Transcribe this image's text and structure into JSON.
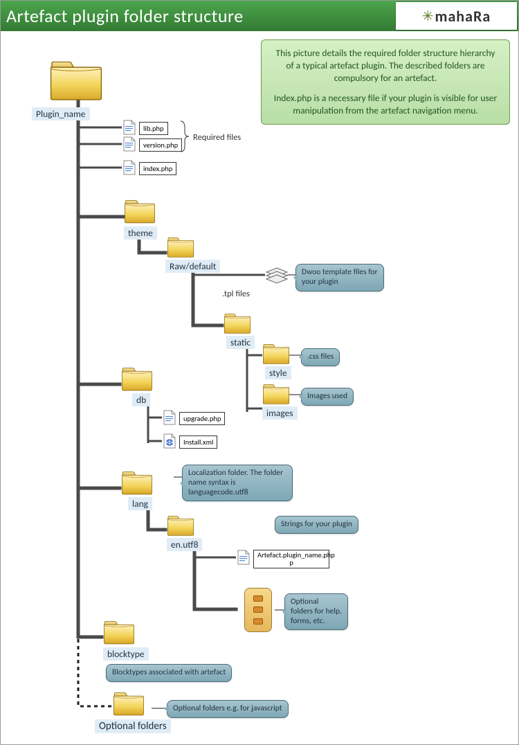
{
  "header": {
    "title": "Artefact plugin  folder structure",
    "logo_text": "mahaRa"
  },
  "info": {
    "p1": "This picture details the required folder structure hierarchy of a typical artefact plugin. The described folders are compulsory for an artefact.",
    "p2": "Index.php is a necessary file if your plugin is visible for user manipulation from the artefact navigation menu."
  },
  "labels": {
    "plugin_name": "Plugin_name",
    "theme": "theme",
    "raw_default": "Raw/default",
    "static": "static",
    "style": "style",
    "images": "images",
    "db": "db",
    "lang": "lang",
    "en_utf8": "en.utf8",
    "blocktype": "blocktype",
    "optional_folders": "Optional folders"
  },
  "files": {
    "lib_php": "lib.php",
    "version_php": "version.php",
    "index_php": "index.php",
    "upgrade_php": "upgrade.php",
    "install_xml": "Install.xml",
    "artefact_plugin": "Artefact.plugin_name.php",
    "artefact_plugin2": "p"
  },
  "notes": {
    "required_files": "Required files",
    "tpl_files": ".tpl files",
    "dwoo": "Dwoo template files for your plugin",
    "css": ".css files",
    "images_used": "Images used",
    "localization": "Localization folder. The folder name syntax is languagecode.utf8",
    "strings": "Strings for your plugin",
    "optional_help": "Optional folders for help, forms, etc.",
    "blocktypes": "Blocktypes associated with artefact",
    "optional_js": "Optional folders e.g. for javascript"
  }
}
